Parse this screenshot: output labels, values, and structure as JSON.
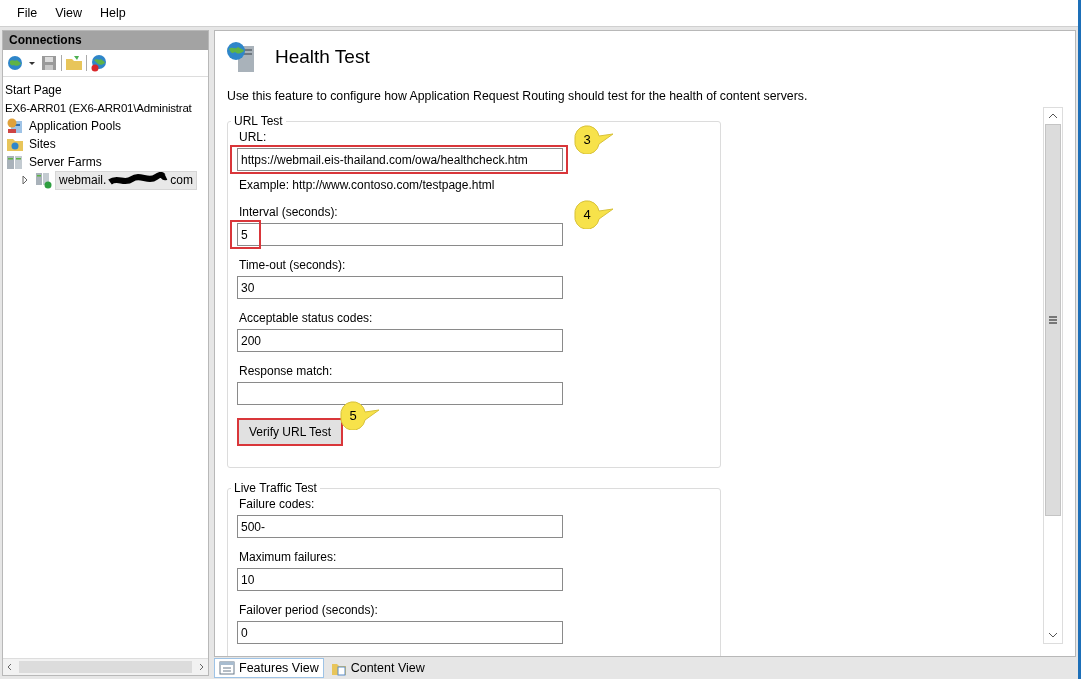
{
  "menu": [
    "File",
    "View",
    "Help"
  ],
  "connections": {
    "title": "Connections",
    "tree": [
      {
        "label": "Start Page",
        "selected": false
      },
      {
        "label": "EX6-ARR01 (EX6-ARR01\\Administrat",
        "selected": false,
        "children": [
          {
            "label": "Application Pools",
            "kind": "pools",
            "selected": false
          },
          {
            "label": "Sites",
            "kind": "sites",
            "selected": false
          },
          {
            "label": "Server Farms",
            "kind": "farms",
            "selected": false,
            "children": [
              {
                "label": "webmail.",
                "suffix": "com",
                "redacted": true,
                "kind": "farm",
                "selected": true,
                "expanded": false
              }
            ]
          }
        ]
      }
    ]
  },
  "page": {
    "title": "Health Test",
    "description": "Use this feature to configure how Application Request Routing should test for the health of content servers.",
    "sections": [
      {
        "legend": "URL Test",
        "items": [
          {
            "kind": "input",
            "label": "URL:",
            "value": "https://webmail.eis-thailand.com/owa/healthcheck.htm",
            "highlighted": true,
            "callout": "3"
          },
          {
            "kind": "note",
            "label": "Example: http://www.contoso.com/testpage.html"
          },
          {
            "kind": "input",
            "label": "Interval (seconds):",
            "value": "5",
            "highlighted": true,
            "callout": "4"
          },
          {
            "kind": "input",
            "label": "Time-out (seconds):",
            "value": "30"
          },
          {
            "kind": "input",
            "label": "Acceptable status codes:",
            "value": "200"
          },
          {
            "kind": "input",
            "label": "Response match:"
          },
          {
            "kind": "button",
            "label": "Verify URL Test",
            "highlighted": true,
            "callout": "5"
          }
        ]
      },
      {
        "legend": "Live Traffic Test",
        "items": [
          {
            "kind": "input",
            "label": "Failure codes:",
            "value": "500-"
          },
          {
            "kind": "input",
            "label": "Maximum failures:",
            "value": "10"
          },
          {
            "kind": "input",
            "label": "Failover period (seconds):",
            "value": "0"
          }
        ]
      }
    ]
  },
  "views": [
    {
      "label": "Features View",
      "selected": true
    },
    {
      "label": "Content View",
      "selected": false
    }
  ]
}
